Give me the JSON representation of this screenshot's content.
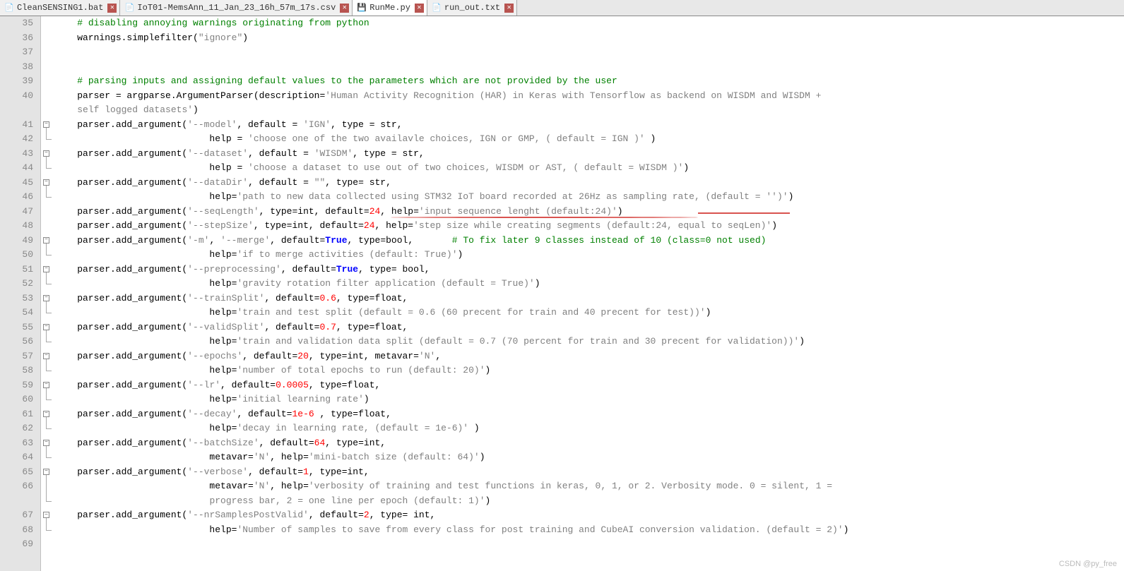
{
  "tabs": [
    {
      "label": "CleanSENSING1.bat",
      "icon": "file",
      "active": false
    },
    {
      "label": "IoT01-MemsAnn_11_Jan_23_16h_57m_17s.csv",
      "icon": "file",
      "active": false
    },
    {
      "label": "RunMe.py",
      "icon": "save",
      "active": true
    },
    {
      "label": "run_out.txt",
      "icon": "file",
      "active": false
    }
  ],
  "line_numbers": [
    "35",
    "36",
    "37",
    "38",
    "39",
    "40",
    " ",
    "41",
    "42",
    "43",
    "44",
    "45",
    "46",
    "47",
    "48",
    "49",
    "50",
    "51",
    "52",
    "53",
    "54",
    "55",
    "56",
    "57",
    "58",
    "59",
    "60",
    "61",
    "62",
    "63",
    "64",
    "65",
    "66",
    " ",
    "67",
    "68",
    "69"
  ],
  "code_lines": [
    {
      "indent": "    ",
      "fragments": [
        {
          "cls": "c-comment",
          "t": "# disabling annoying warnings originating from python"
        }
      ]
    },
    {
      "indent": "    ",
      "fragments": [
        {
          "t": "warnings.simplefilter("
        },
        {
          "cls": "c-str",
          "t": "\"ignore\""
        },
        {
          "t": ")"
        }
      ]
    },
    {
      "indent": "",
      "fragments": []
    },
    {
      "indent": "",
      "fragments": []
    },
    {
      "indent": "    ",
      "fragments": [
        {
          "cls": "c-comment",
          "t": "# parsing inputs and assigning default values to the parameters which are not provided by the user"
        }
      ]
    },
    {
      "indent": "    ",
      "fragments": [
        {
          "t": "parser = argparse.ArgumentParser(description="
        },
        {
          "cls": "c-str",
          "t": "'Human Activity Recognition (HAR) in Keras with Tensorflow as backend on WISDM and WISDM + "
        }
      ]
    },
    {
      "indent": "    ",
      "fragments": [
        {
          "cls": "c-str",
          "t": "self logged datasets'"
        },
        {
          "t": ")"
        }
      ]
    },
    {
      "indent": "    ",
      "fragments": [
        {
          "t": "parser.add_argument("
        },
        {
          "cls": "c-str",
          "t": "'--model'"
        },
        {
          "t": ", default = "
        },
        {
          "cls": "c-str",
          "t": "'IGN'"
        },
        {
          "t": ", type = str,"
        }
      ]
    },
    {
      "indent": "                            ",
      "fragments": [
        {
          "t": "help = "
        },
        {
          "cls": "c-str",
          "t": "'choose one of the two availavle choices, IGN or GMP, ( default = IGN )'"
        },
        {
          "t": " )"
        }
      ]
    },
    {
      "indent": "    ",
      "fragments": [
        {
          "t": "parser.add_argument("
        },
        {
          "cls": "c-str",
          "t": "'--dataset'"
        },
        {
          "t": ", default = "
        },
        {
          "cls": "c-str",
          "t": "'WISDM'"
        },
        {
          "t": ", type = str,"
        }
      ]
    },
    {
      "indent": "                            ",
      "fragments": [
        {
          "t": "help = "
        },
        {
          "cls": "c-str",
          "t": "'choose a dataset to use out of two choices, WISDM or AST, ( default = WISDM )'"
        },
        {
          "t": ")"
        }
      ]
    },
    {
      "indent": "    ",
      "fragments": [
        {
          "t": "parser.add_argument("
        },
        {
          "cls": "c-str",
          "t": "'--dataDir'"
        },
        {
          "t": ", default = "
        },
        {
          "cls": "c-str",
          "t": "\"\""
        },
        {
          "t": ", type= str,"
        }
      ]
    },
    {
      "indent": "                            ",
      "fragments": [
        {
          "t": "help="
        },
        {
          "cls": "c-str",
          "t": "'path to new data collected using STM32 IoT board recorded at 26Hz as sampling rate, (default = '')'"
        },
        {
          "t": ")"
        }
      ]
    },
    {
      "indent": "    ",
      "fragments": [
        {
          "t": "parser.add_argument("
        },
        {
          "cls": "c-str",
          "t": "'--seqLength'"
        },
        {
          "t": ", type=int, default="
        },
        {
          "cls": "c-num",
          "t": "24"
        },
        {
          "t": ", help="
        },
        {
          "cls": "c-str",
          "t": "'input sequence lenght (default:24)'"
        },
        {
          "t": ")"
        }
      ]
    },
    {
      "indent": "    ",
      "fragments": [
        {
          "t": "parser.add_argument("
        },
        {
          "cls": "c-str",
          "t": "'--stepSize'"
        },
        {
          "t": ", type=int, default="
        },
        {
          "cls": "c-num",
          "t": "24"
        },
        {
          "t": ", help="
        },
        {
          "cls": "c-str",
          "t": "'step size while creating segments (default:24, equal to seqLen)'"
        },
        {
          "t": ")"
        }
      ]
    },
    {
      "indent": "    ",
      "fragments": [
        {
          "t": "parser.add_argument("
        },
        {
          "cls": "c-str",
          "t": "'-m'"
        },
        {
          "t": ", "
        },
        {
          "cls": "c-str",
          "t": "'--merge'"
        },
        {
          "t": ", default="
        },
        {
          "cls": "c-bool",
          "t": "True"
        },
        {
          "t": ", type=bool,       "
        },
        {
          "cls": "c-comment",
          "t": "# To fix later 9 classes instead of 10 (class=0 not used)"
        }
      ]
    },
    {
      "indent": "                            ",
      "fragments": [
        {
          "t": "help="
        },
        {
          "cls": "c-str",
          "t": "'if to merge activities (default: True)'"
        },
        {
          "t": ")"
        }
      ]
    },
    {
      "indent": "    ",
      "fragments": [
        {
          "t": "parser.add_argument("
        },
        {
          "cls": "c-str",
          "t": "'--preprocessing'"
        },
        {
          "t": ", default="
        },
        {
          "cls": "c-bool",
          "t": "True"
        },
        {
          "t": ", type= bool,"
        }
      ]
    },
    {
      "indent": "                            ",
      "fragments": [
        {
          "t": "help="
        },
        {
          "cls": "c-str",
          "t": "'gravity rotation filter application (default = True)'"
        },
        {
          "t": ")"
        }
      ]
    },
    {
      "indent": "    ",
      "fragments": [
        {
          "t": "parser.add_argument("
        },
        {
          "cls": "c-str",
          "t": "'--trainSplit'"
        },
        {
          "t": ", default="
        },
        {
          "cls": "c-num",
          "t": "0.6"
        },
        {
          "t": ", type=float,"
        }
      ]
    },
    {
      "indent": "                            ",
      "fragments": [
        {
          "t": "help="
        },
        {
          "cls": "c-str",
          "t": "'train and test split (default = 0.6 (60 precent for train and 40 precent for test))'"
        },
        {
          "t": ")"
        }
      ]
    },
    {
      "indent": "    ",
      "fragments": [
        {
          "t": "parser.add_argument("
        },
        {
          "cls": "c-str",
          "t": "'--validSplit'"
        },
        {
          "t": ", default="
        },
        {
          "cls": "c-num",
          "t": "0.7"
        },
        {
          "t": ", type=float,"
        }
      ]
    },
    {
      "indent": "                            ",
      "fragments": [
        {
          "t": "help="
        },
        {
          "cls": "c-str",
          "t": "'train and validation data split (default = 0.7 (70 percent for train and 30 precent for validation))'"
        },
        {
          "t": ")"
        }
      ]
    },
    {
      "indent": "    ",
      "fragments": [
        {
          "t": "parser.add_argument("
        },
        {
          "cls": "c-str",
          "t": "'--epochs'"
        },
        {
          "t": ", default="
        },
        {
          "cls": "c-num",
          "t": "20"
        },
        {
          "t": ", type=int, metavar="
        },
        {
          "cls": "c-str",
          "t": "'N'"
        },
        {
          "t": ","
        }
      ]
    },
    {
      "indent": "                            ",
      "fragments": [
        {
          "t": "help="
        },
        {
          "cls": "c-str",
          "t": "'number of total epochs to run (default: 20)'"
        },
        {
          "t": ")"
        }
      ]
    },
    {
      "indent": "    ",
      "fragments": [
        {
          "t": "parser.add_argument("
        },
        {
          "cls": "c-str",
          "t": "'--lr'"
        },
        {
          "t": ", default="
        },
        {
          "cls": "c-num",
          "t": "0.0005"
        },
        {
          "t": ", type=float,"
        }
      ]
    },
    {
      "indent": "                            ",
      "fragments": [
        {
          "t": "help="
        },
        {
          "cls": "c-str",
          "t": "'initial learning rate'"
        },
        {
          "t": ")"
        }
      ]
    },
    {
      "indent": "    ",
      "fragments": [
        {
          "t": "parser.add_argument("
        },
        {
          "cls": "c-str",
          "t": "'--decay'"
        },
        {
          "t": ", default="
        },
        {
          "cls": "c-num",
          "t": "1e-6"
        },
        {
          "t": " , type=float,"
        }
      ]
    },
    {
      "indent": "                            ",
      "fragments": [
        {
          "t": "help="
        },
        {
          "cls": "c-str",
          "t": "'decay in learning rate, (default = 1e-6)'"
        },
        {
          "t": " )"
        }
      ]
    },
    {
      "indent": "    ",
      "fragments": [
        {
          "t": "parser.add_argument("
        },
        {
          "cls": "c-str",
          "t": "'--batchSize'"
        },
        {
          "t": ", default="
        },
        {
          "cls": "c-num",
          "t": "64"
        },
        {
          "t": ", type=int,"
        }
      ]
    },
    {
      "indent": "                            ",
      "fragments": [
        {
          "t": "metavar="
        },
        {
          "cls": "c-str",
          "t": "'N'"
        },
        {
          "t": ", help="
        },
        {
          "cls": "c-str",
          "t": "'mini-batch size (default: 64)'"
        },
        {
          "t": ")"
        }
      ]
    },
    {
      "indent": "    ",
      "fragments": [
        {
          "t": "parser.add_argument("
        },
        {
          "cls": "c-str",
          "t": "'--verbose'"
        },
        {
          "t": ", default="
        },
        {
          "cls": "c-num",
          "t": "1"
        },
        {
          "t": ", type=int,"
        }
      ]
    },
    {
      "indent": "                            ",
      "fragments": [
        {
          "t": "metavar="
        },
        {
          "cls": "c-str",
          "t": "'N'"
        },
        {
          "t": ", help="
        },
        {
          "cls": "c-str",
          "t": "'verbosity of training and test functions in keras, 0, 1, or 2. Verbosity mode. 0 = silent, 1 = "
        }
      ]
    },
    {
      "indent": "                            ",
      "fragments": [
        {
          "cls": "c-str",
          "t": "progress bar, 2 = one line per epoch (default: 1)'"
        },
        {
          "t": ")"
        }
      ]
    },
    {
      "indent": "    ",
      "fragments": [
        {
          "t": "parser.add_argument("
        },
        {
          "cls": "c-str",
          "t": "'--nrSamplesPostValid'"
        },
        {
          "t": ", default="
        },
        {
          "cls": "c-num",
          "t": "2"
        },
        {
          "t": ", type= int,"
        }
      ]
    },
    {
      "indent": "                            ",
      "fragments": [
        {
          "t": "help="
        },
        {
          "cls": "c-str",
          "t": "'Number of samples to save from every class for post training and CubeAI conversion validation. (default = 2)'"
        },
        {
          "t": ")"
        }
      ]
    },
    {
      "indent": "",
      "fragments": []
    }
  ],
  "fold_markers": [
    7,
    9,
    11,
    15,
    17,
    19,
    21,
    23,
    25,
    27,
    29,
    31,
    34
  ],
  "watermark": "CSDN @py_free"
}
